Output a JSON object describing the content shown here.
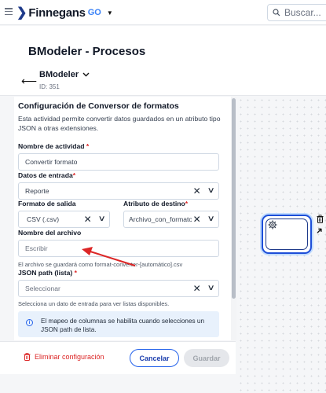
{
  "topbar": {
    "brand_name": "Finnegans",
    "brand_suffix": "GO",
    "search_placeholder": "Buscar..."
  },
  "header": {
    "page_title": "BModeler - Procesos",
    "process_name": "BModeler",
    "process_id": "ID: 351"
  },
  "config": {
    "title": "Configuración de Conversor de formatos",
    "description": "Esta actividad permite convertir datos guardados en un atributo tipo JSON a otras extensiones.",
    "activity_name": {
      "label": "Nombre de actividad",
      "value": "Convertir formato"
    },
    "input_data": {
      "label": "Datos de entrada",
      "value": "Reporte"
    },
    "output_format": {
      "label": "Formato de salida",
      "value": "CSV (.csv)"
    },
    "target_attribute": {
      "label": "Atributo de destino",
      "value": "Archivo_con_formato"
    },
    "file_name": {
      "label": "Nombre del archivo",
      "placeholder": "Escribir",
      "hint": "El archivo se guardará como format-converter-[automático].csv"
    },
    "json_path": {
      "label": "JSON path (lista)",
      "placeholder": "Seleccionar",
      "hint": "Selecciona un dato de entrada para ver listas disponibles."
    },
    "info_message": "El mapeo de columnas se habilita cuando selecciones un JSON path de lista.",
    "required_mark": "*"
  },
  "footer": {
    "delete_label": "Eliminar configuración",
    "cancel_label": "Cancelar",
    "save_label": "Guardar"
  },
  "icons": {
    "menu": "hamburger-menu-icon",
    "logo": "chevron-logo-icon",
    "search": "search-icon",
    "back": "arrow-left-icon",
    "clear": "close-icon",
    "dropdown": "chevron-down-icon",
    "info": "info-icon",
    "delete": "trash-icon",
    "task": "gear-icon",
    "connect": "arrow-icon"
  },
  "colors": {
    "accent": "#2563eb",
    "danger": "#dc2626",
    "brand_dark": "#1e3a8a",
    "info_bg": "#e8f1fc",
    "annotation_arrow": "#dc2626"
  }
}
